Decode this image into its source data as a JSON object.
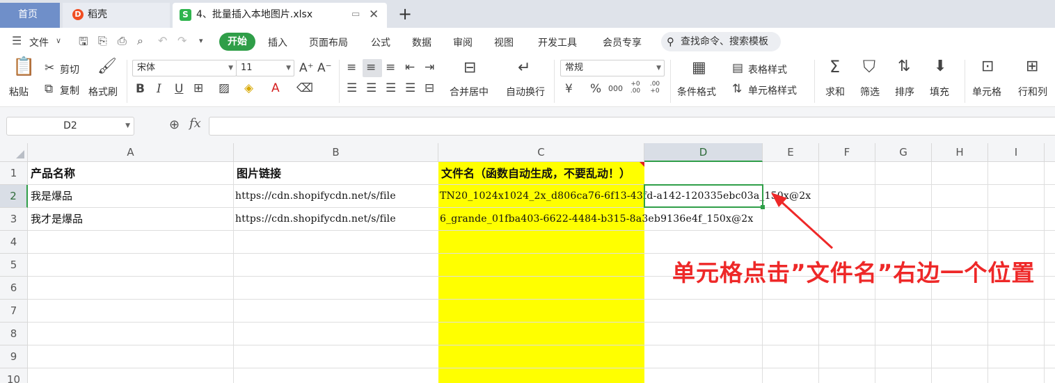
{
  "tabs": {
    "home": "首页",
    "daoke": "稻壳",
    "daoke_icon": "D",
    "file": "4、批量插入本地图片.xlsx",
    "file_icon": "S",
    "add": "+"
  },
  "menu": {
    "file": "文件",
    "start": "开始",
    "items": [
      "插入",
      "页面布局",
      "公式",
      "数据",
      "审阅",
      "视图",
      "开发工具",
      "会员专享"
    ],
    "search": "查找命令、搜索模板"
  },
  "ribbon": {
    "paste": "粘贴",
    "cut": "剪切",
    "copy": "复制",
    "format_painter": "格式刷",
    "font_name": "宋体",
    "font_size": "11",
    "merge_center": "合并居中",
    "wrap_text": "自动换行",
    "number_format": "常规",
    "conditional_format": "条件格式",
    "table_style": "表格样式",
    "cell_style": "单元格样式",
    "sum": "求和",
    "filter": "筛选",
    "sort": "排序",
    "fill": "填充",
    "cells": "单元格",
    "row_col": "行和列",
    "currency": "¥",
    "percent": "%",
    "thousands": "000",
    "inc_decimal": "+0 .00",
    "dec_decimal": ".00 +0",
    "bold": "B",
    "italic": "I",
    "underline": "U"
  },
  "formula_bar": {
    "name_box": "D2",
    "fx": "fx",
    "value": ""
  },
  "sheet": {
    "columns": [
      "A",
      "B",
      "C",
      "D",
      "E",
      "F",
      "G",
      "H",
      "I"
    ],
    "rows": [
      "1",
      "2",
      "3",
      "4",
      "5",
      "6",
      "7",
      "8",
      "9",
      "10"
    ],
    "selected_cell": "D2",
    "cells": {
      "A1": "产品名称",
      "B1": "图片链接",
      "C1": "文件名（函数自动生成，不要乱动！）",
      "A2": "我是爆品",
      "B2": "https://cdn.shopifycdn.net/s/file",
      "C2": "TN20_1024x1024_2x_d806ca76-6f13-43fd-a142-120335ebc03a_150x@2x",
      "A3": "我才是爆品",
      "B3": "https://cdn.shopifycdn.net/s/file",
      "C3": "6_grande_01fba403-6622-4484-b315-8a3eb9136e4f_150x@2x"
    },
    "highlight_color": "#ffff00",
    "selection_color": "#2f9e48"
  },
  "annotation": {
    "text": "单元格点击”文件名”右边一个位置",
    "color": "#ee2828"
  }
}
